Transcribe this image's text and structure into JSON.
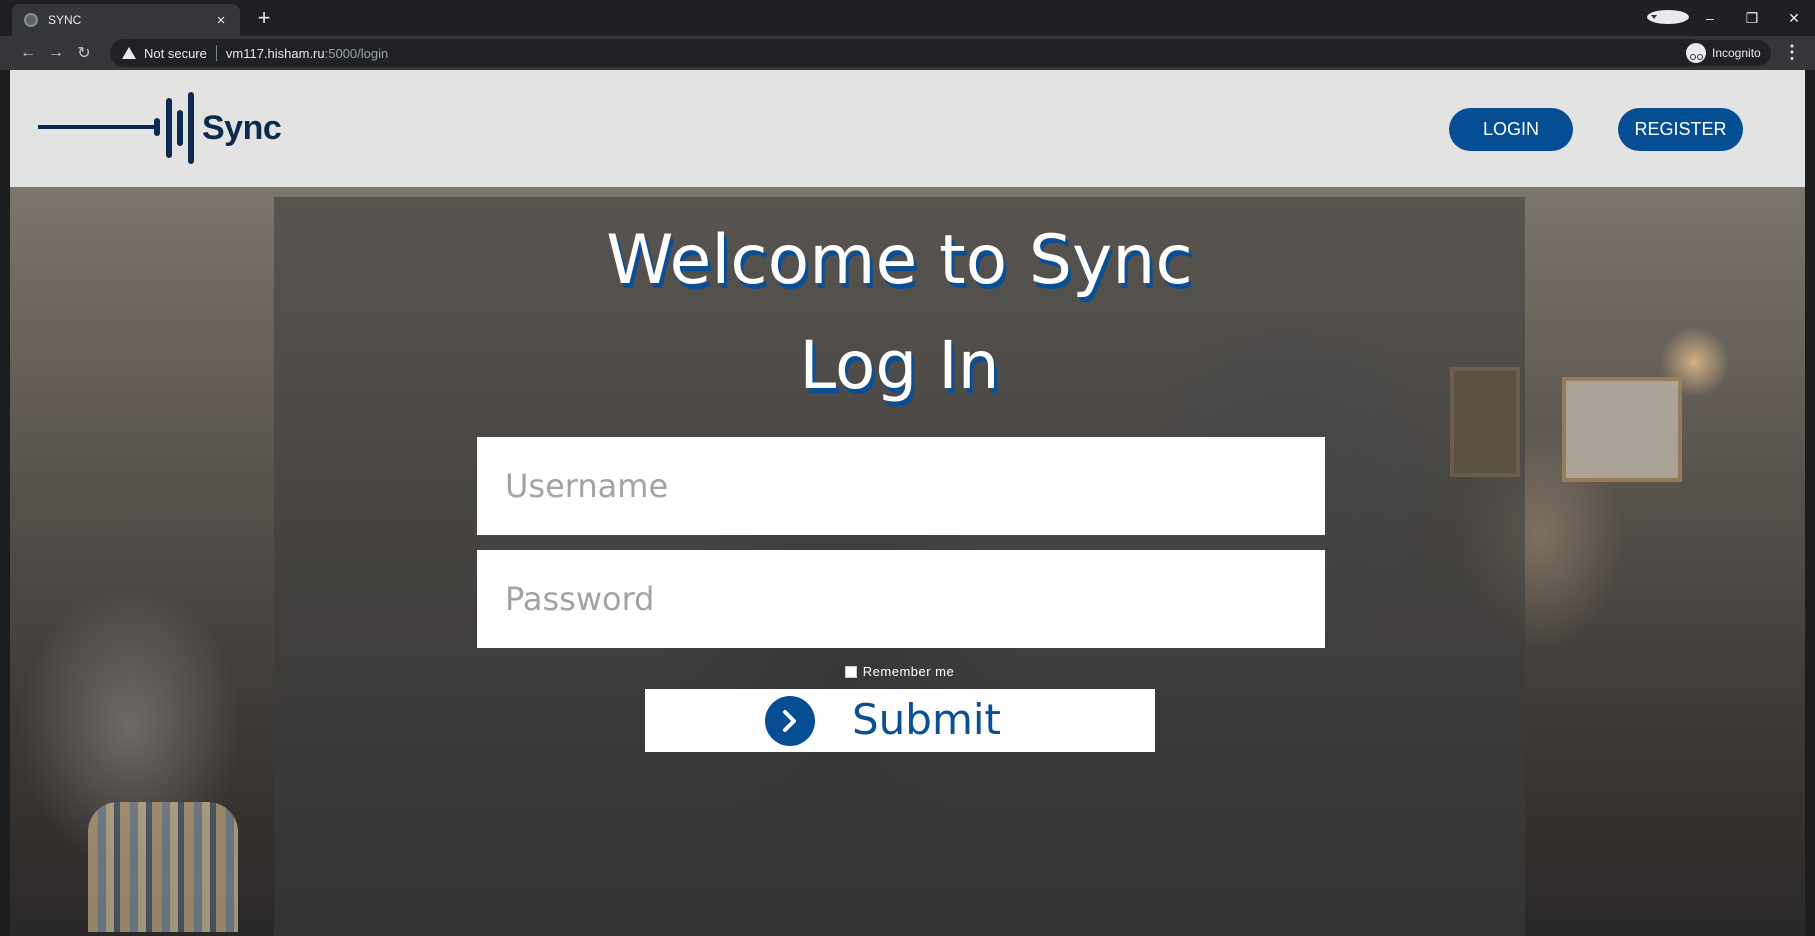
{
  "browser": {
    "tab_title": "SYNC",
    "tab_close": "×",
    "new_tab": "+",
    "security_label": "Not secure",
    "url_host": "vm117.hisham.ru",
    "url_rest": ":5000/login",
    "profile_label": "Incognito"
  },
  "header": {
    "logo_text": "Sync",
    "nav": {
      "login_label": "LOGIN",
      "register_label": "REGISTER"
    }
  },
  "login_form": {
    "welcome_title": "Welcome to Sync",
    "title": "Log In",
    "username_placeholder": "Username",
    "password_placeholder": "Password",
    "remember_label": "Remember me",
    "submit_label": "Submit"
  },
  "colors": {
    "brand_blue": "#064e93",
    "logo_navy": "#0c2a4f",
    "header_bg": "#e3e3e3"
  }
}
